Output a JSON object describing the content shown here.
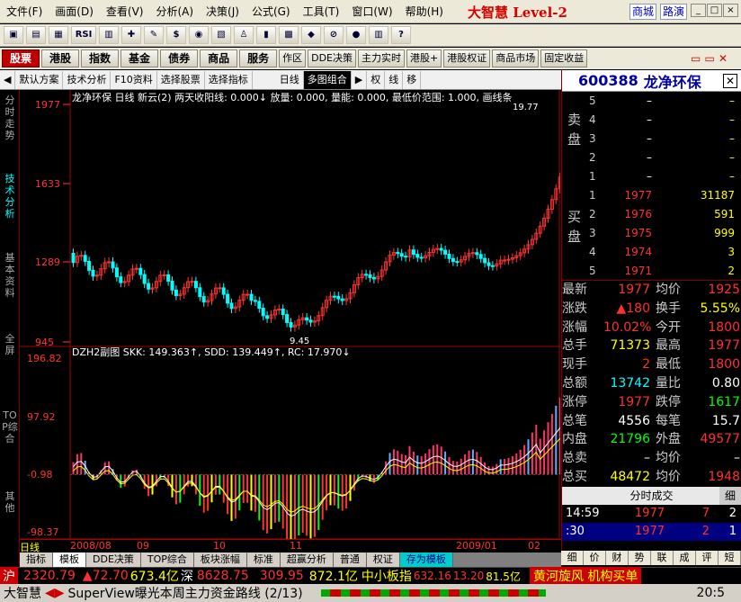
{
  "menu": {
    "items": [
      "文件(F)",
      "画面(D)",
      "查看(V)",
      "分析(A)",
      "决策(J)",
      "公式(G)",
      "工具(T)",
      "窗口(W)",
      "帮助(H)"
    ],
    "brand": "大智慧 Level-2",
    "links": [
      "商城",
      "路演"
    ],
    "window_buttons": [
      "_",
      "□",
      "×"
    ]
  },
  "toolbar": {
    "icons": [
      "folder-icon",
      "chart-icon",
      "grid-icon",
      "rsi-icon",
      "table-icon",
      "cross-icon",
      "draw-icon",
      "dollar-icon",
      "vip-icon",
      "page-icon",
      "binoculars-icon",
      "bars-icon",
      "card-icon",
      "diamond-icon",
      "no-icon",
      "redcircle-icon",
      "books-icon",
      "help-icon"
    ],
    "rsi_label": "RSI"
  },
  "tabs": [
    "股票",
    "港股",
    "指数",
    "基金",
    "债券",
    "商品",
    "服务",
    "作区",
    "DDE决策",
    "主力实时",
    "港股+",
    "港股权证",
    "商品市场",
    "固定收益"
  ],
  "active_tab": "股票",
  "subbar": [
    "默认方案",
    "技术分析",
    "F10资料",
    "选择股票",
    "选择指标",
    "日线",
    "多图组合"
  ],
  "sub_icons": [
    "权",
    "线",
    "移"
  ],
  "left_tabs": [
    "分时走势",
    "技术分析",
    "基本资料",
    "全屏",
    "TOP综合",
    "其他"
  ],
  "stock": {
    "code": "600388",
    "name": "龙净环保"
  },
  "chart": {
    "legend": "龙净环保 日线  新云(2)  两天收阳线: 0.000↓  放量: 0.000, 量能: 0.000, 最低价范围: 1.000, 画线条",
    "y_ticks": [
      "1977",
      "1633",
      "1289",
      "945"
    ],
    "low_mark": "9.45",
    "high_mark": "19.77",
    "sub_legend": "DZH2副图 SKK: 149.363↑, SDD: 139.449↑, RC: 17.970↓",
    "sub_ticks": [
      "196.82",
      "97.92",
      "-0.98",
      "-98.37"
    ],
    "x_labels": [
      "2008/08",
      "09",
      "10",
      "11",
      "2009/01",
      "02"
    ],
    "period_label": "日线"
  },
  "chart_data": {
    "type": "line",
    "title": "龙净环保 日线",
    "main_ylim": [
      945,
      1977
    ],
    "sub_ylim": [
      -98.37,
      196.82
    ],
    "series": [
      {
        "name": "SKK",
        "last": 149.363
      },
      {
        "name": "SDD",
        "last": 139.449
      },
      {
        "name": "RC",
        "last": 17.97
      }
    ]
  },
  "orderbook": {
    "sell_label": "卖盘",
    "buy_label": "买盘",
    "sells": [
      {
        "n": "5",
        "p": "–",
        "v": "–"
      },
      {
        "n": "4",
        "p": "–",
        "v": "–"
      },
      {
        "n": "3",
        "p": "–",
        "v": "–"
      },
      {
        "n": "2",
        "p": "–",
        "v": "–"
      },
      {
        "n": "1",
        "p": "–",
        "v": "–"
      }
    ],
    "buys": [
      {
        "n": "1",
        "p": "1977",
        "v": "31187"
      },
      {
        "n": "2",
        "p": "1976",
        "v": "591"
      },
      {
        "n": "3",
        "p": "1975",
        "v": "999"
      },
      {
        "n": "4",
        "p": "1974",
        "v": "3"
      },
      {
        "n": "5",
        "p": "1971",
        "v": "2"
      }
    ]
  },
  "stats": [
    {
      "k1": "最新",
      "v1": "1977",
      "c1": "red",
      "k2": "均价",
      "v2": "1925",
      "c2": "red"
    },
    {
      "k1": "涨跌",
      "v1": "▲180",
      "c1": "red",
      "k2": "换手",
      "v2": "5.55%",
      "c2": "yel"
    },
    {
      "k1": "涨幅",
      "v1": "10.02%",
      "c1": "red",
      "k2": "今开",
      "v2": "1800",
      "c2": "red"
    },
    {
      "k1": "总手",
      "v1": "71373",
      "c1": "yel",
      "k2": "最高",
      "v2": "1977",
      "c2": "red"
    },
    {
      "k1": "现手",
      "v1": "2",
      "c1": "red",
      "k2": "最低",
      "v2": "1800",
      "c2": "red"
    },
    {
      "k1": "总额",
      "v1": "13742",
      "c1": "cyn",
      "k2": "量比",
      "v2": "0.80",
      "c2": "wht"
    },
    {
      "k1": "涨停",
      "v1": "1977",
      "c1": "red",
      "k2": "跌停",
      "v2": "1617",
      "c2": "grn"
    },
    {
      "k1": "总笔",
      "v1": "4556",
      "c1": "wht",
      "k2": "每笔",
      "v2": "15.7",
      "c2": "wht"
    },
    {
      "k1": "内盘",
      "v1": "21796",
      "c1": "grn",
      "k2": "外盘",
      "v2": "49577",
      "c2": "red"
    },
    {
      "k1": "总卖",
      "v1": "–",
      "c1": "wht",
      "k2": "均价",
      "v2": "–",
      "c2": "wht"
    },
    {
      "k1": "总买",
      "v1": "48472",
      "c1": "yel",
      "k2": "均价",
      "v2": "1948",
      "c2": "red"
    }
  ],
  "trades": {
    "title": "分时成交",
    "more": "细",
    "rows": [
      {
        "t": "14:59",
        "p": "1977",
        "v": "7",
        "n": "2"
      },
      {
        "t": ":30",
        "p": "1977",
        "v": "2",
        "n": "1"
      }
    ]
  },
  "right_tabs": [
    "细",
    "价",
    "财",
    "势",
    "联",
    "成",
    "评",
    "短"
  ],
  "bottom_tabs": [
    "指标",
    "模板",
    "DDE决策",
    "TOP综合",
    "板块涨幅",
    "标准",
    "超赢分析",
    "普通",
    "权证",
    "存为模板"
  ],
  "status1": {
    "a": "沪",
    "b": "2320.79",
    "c": "▲72.70",
    "d": "673.4亿",
    "e": "深",
    "f": "8628.75",
    "g": "309.95",
    "h": "872.1亿",
    "i": "中小板指",
    "j": "632.16",
    "k": "13.20",
    "l": "81.5亿",
    "m": "黄河旋风 机构买单"
  },
  "status2": {
    "a": "大智慧",
    "b": "SuperView曝光本周主力资金路线 (2/13)",
    "c": "20:5"
  }
}
